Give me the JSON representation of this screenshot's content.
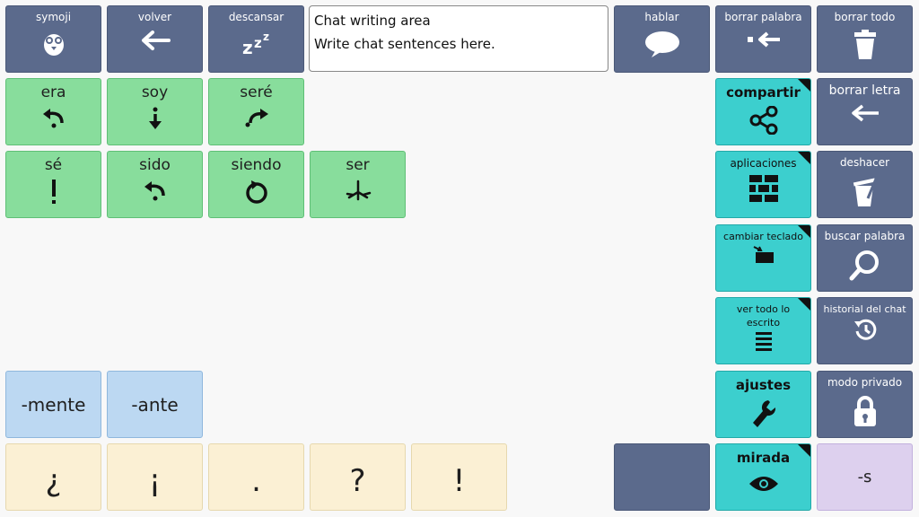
{
  "top": {
    "symoji": "symoji",
    "volver": "volver",
    "descansar": "descansar",
    "hablar": "hablar",
    "borrar_palabra": "borrar palabra",
    "borrar_todo": "borrar todo"
  },
  "chat": {
    "title": "Chat writing area",
    "placeholder": "Write chat sentences here."
  },
  "verbs": {
    "era": "era",
    "soy": "soy",
    "sere": "seré",
    "se": "sé",
    "sido": "sido",
    "siendo": "siendo",
    "ser": "ser"
  },
  "suffixes": {
    "mente": "-mente",
    "ante": "-ante",
    "s": "-s"
  },
  "punctuation": [
    "¿",
    "¡",
    ".",
    "?",
    "!"
  ],
  "tools": {
    "compartir": "compartir",
    "borrar_letra": "borrar letra",
    "aplicaciones": "aplicaciones",
    "deshacer": "deshacer",
    "cambiar_teclado": "cambiar teclado",
    "buscar_palabra": "buscar palabra",
    "ver_todo": "ver todo lo escrito",
    "historial": "historial del chat",
    "ajustes": "ajustes",
    "modo_privado": "modo privado",
    "mirada": "mirada"
  }
}
